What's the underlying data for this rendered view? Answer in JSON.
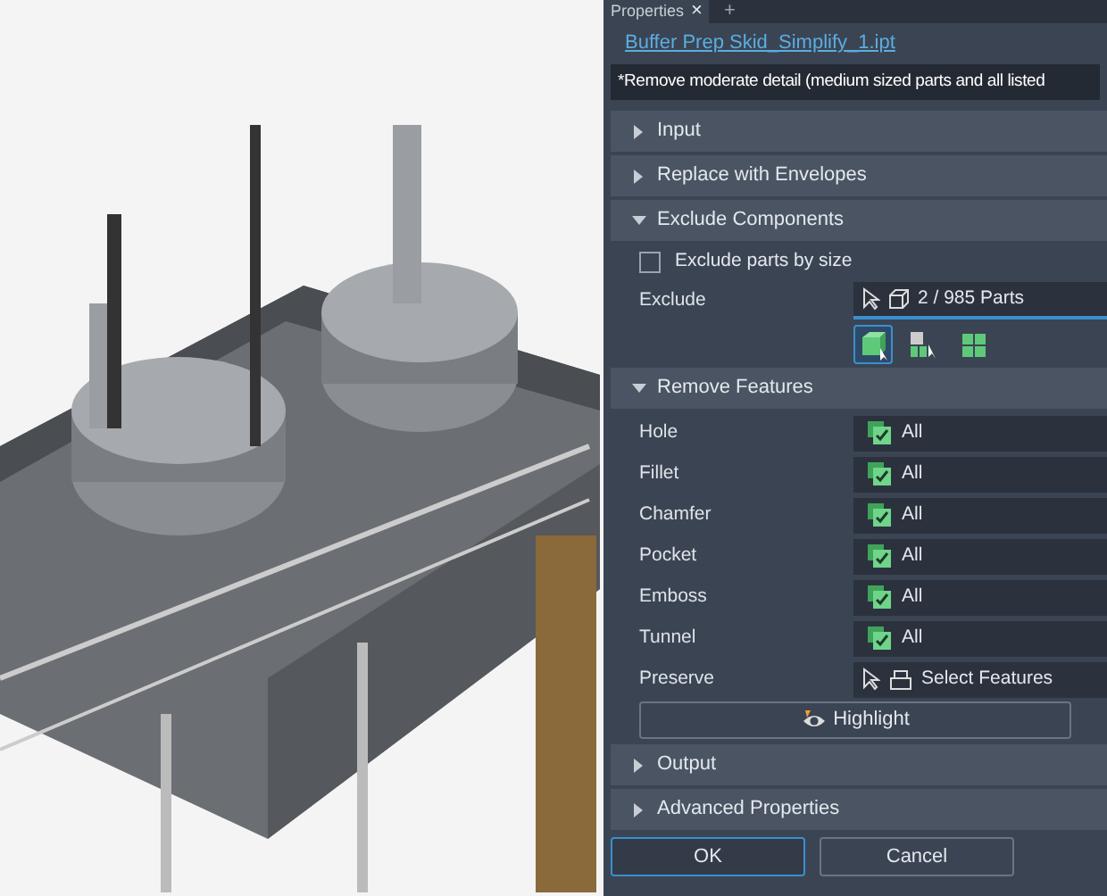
{
  "tab": {
    "label": "Properties",
    "close": "×",
    "add": "+"
  },
  "file_link": "Buffer Prep Skid_Simplify_1.ipt",
  "description": "*Remove moderate detail (medium sized parts and all listed",
  "sections": [
    {
      "kind": "plain",
      "title": "Input",
      "expanded": false
    },
    {
      "kind": "plain",
      "title": "Replace with Envelopes",
      "expanded": false
    },
    {
      "kind": "exclude",
      "title": "Exclude Components",
      "expanded": true,
      "checkbox": {
        "label": "Exclude parts by size",
        "checked": false
      },
      "exclude_label": "Exclude",
      "exclude_value": "2 / 985 Parts",
      "modes": [
        {
          "selected": true
        },
        {
          "selected": false
        },
        {
          "selected": false
        }
      ]
    },
    {
      "kind": "features",
      "title": "Remove Features",
      "expanded": true,
      "rows": [
        {
          "label": "Hole",
          "value": "All"
        },
        {
          "label": "Fillet",
          "value": "All"
        },
        {
          "label": "Chamfer",
          "value": "All"
        },
        {
          "label": "Pocket",
          "value": "All"
        },
        {
          "label": "Emboss",
          "value": "All"
        },
        {
          "label": "Tunnel",
          "value": "All"
        }
      ],
      "preserve_label": "Preserve",
      "preserve_value": "Select Features",
      "highlight": "Highlight"
    },
    {
      "kind": "plain",
      "title": "Output",
      "expanded": false
    },
    {
      "kind": "plain",
      "title": "Advanced Properties",
      "expanded": false
    }
  ],
  "buttons": [
    {
      "label": "OK",
      "selected": true
    },
    {
      "label": "Cancel",
      "selected": false
    }
  ]
}
